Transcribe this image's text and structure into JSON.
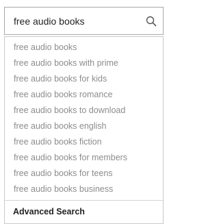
{
  "search": {
    "value": "free audio books",
    "icon": "search-icon"
  },
  "suggestions": [
    "free audio books",
    "free audio books with prime",
    "free audio books for kids",
    "free audio books romance",
    "free audio books to download",
    "free audio books english",
    "free audio books fiction",
    "free audio books for members",
    "free audio books for teens",
    "free audio books business"
  ],
  "advanced_search_label": "Advanced Search",
  "colors": {
    "suggestion_text": "#8c8c8c",
    "input_text": "#222222",
    "border": "#a8a8a8"
  }
}
